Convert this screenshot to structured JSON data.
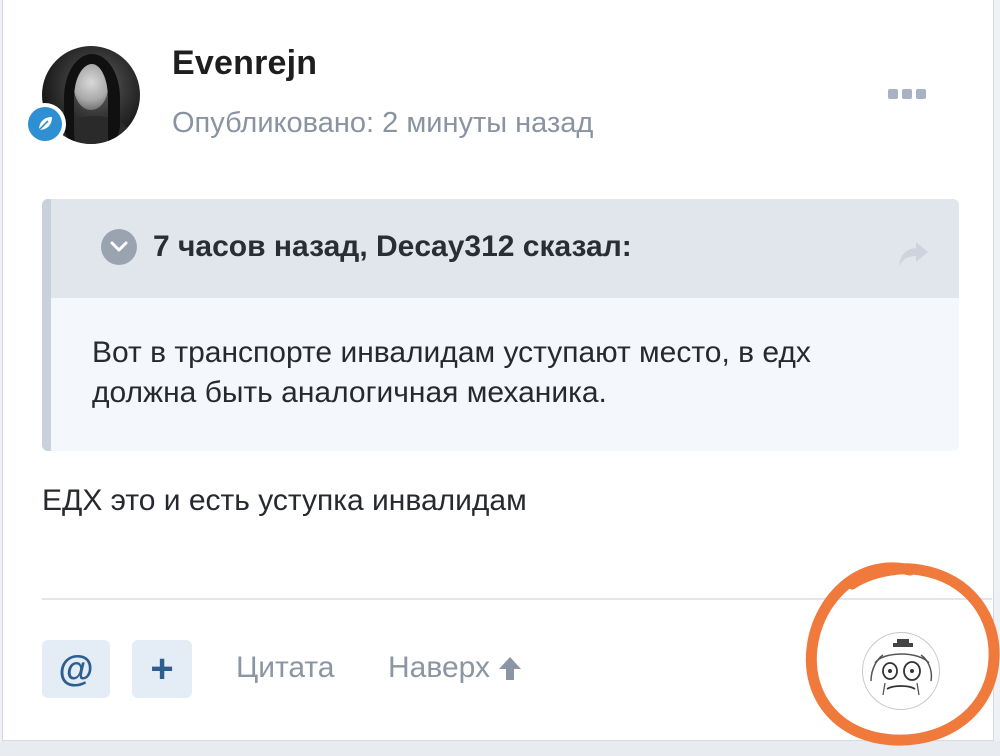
{
  "post": {
    "author": "Evenrejn",
    "published_label": "Опубликовано:",
    "published_time": "2 минуты назад",
    "quote": {
      "header": "7 часов назад, Decay312 сказал:",
      "text": "Вот в транспорте инвалидам уступают место, в едх должна быть аналогичная механика."
    },
    "reply_text": "ЕДХ это и есть уступка инвалидам"
  },
  "footer": {
    "mention_label": "@",
    "plus_label": "+",
    "quote_link": "Цитата",
    "top_link": "Наверх"
  },
  "colors": {
    "accent": "#2c5f8f",
    "muted": "#8b95a3",
    "badge_blue": "#2f8fd3",
    "annotation": "#f07a3c"
  },
  "icons": [
    "avatar",
    "verified-leaf-icon",
    "more-dots-icon",
    "chevron-down-icon",
    "share-arrow-icon",
    "arrow-up-icon",
    "reaction-face-icon"
  ]
}
